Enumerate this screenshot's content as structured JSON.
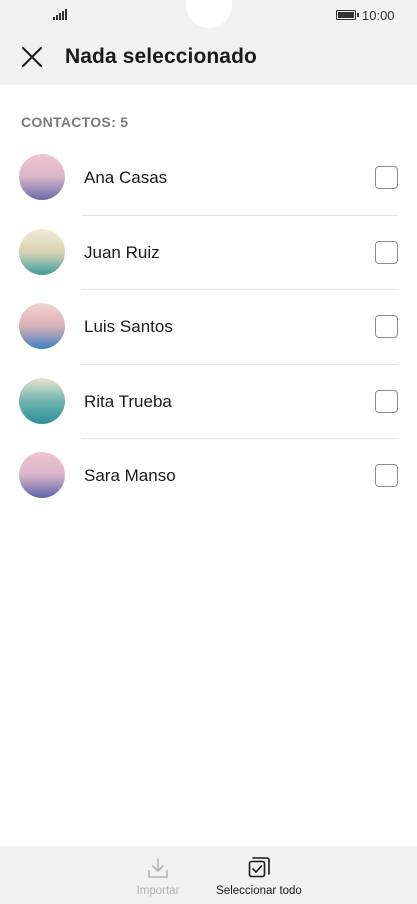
{
  "status_bar": {
    "time": "10:00",
    "icons": [
      "signal-icon",
      "battery-icon"
    ]
  },
  "header": {
    "close_icon": "close-icon",
    "title": "Nada seleccionado"
  },
  "contacts": {
    "count_label": "CONTACTOS: 5",
    "items": [
      {
        "name": "Ana Casas",
        "avatar_colors": [
          "#f2c5d0",
          "#d9b4c9",
          "#6b6aa8"
        ],
        "checked": false
      },
      {
        "name": "Juan Ruiz",
        "avatar_colors": [
          "#f3ead2",
          "#d8d3b5",
          "#3f9d9e"
        ],
        "checked": false
      },
      {
        "name": "Luis Santos",
        "avatar_colors": [
          "#f3d3d3",
          "#dab0b6",
          "#3f7fbf"
        ],
        "checked": false
      },
      {
        "name": "Rita Trueba",
        "avatar_colors": [
          "#e9e3cf",
          "#6fb5b0",
          "#2f8f96"
        ],
        "checked": false
      },
      {
        "name": "Sara Manso",
        "avatar_colors": [
          "#f2c5d0",
          "#d9b4c9",
          "#5d63a6"
        ],
        "checked": false
      }
    ]
  },
  "bottom_bar": {
    "import_label": "Importar",
    "import_enabled": false,
    "select_all_label": "Seleccionar todo"
  },
  "colors": {
    "bar_background": "#f1f1f1",
    "divider": "#e3e3e3",
    "disabled_text": "#b3b3b3"
  }
}
